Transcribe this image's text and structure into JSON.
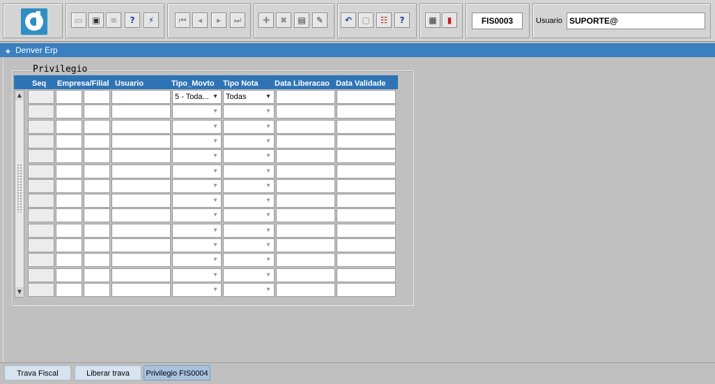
{
  "toolbar": {
    "form_code": "FIS0003",
    "user_label": "Usuario",
    "user_value": "SUPORTE@",
    "buttons": [
      {
        "name": "save-icon",
        "glyph": "▭"
      },
      {
        "name": "print-preview-icon",
        "glyph": "▣"
      },
      {
        "name": "printer-icon",
        "glyph": "≡"
      },
      {
        "name": "query-help-icon",
        "glyph": "?"
      },
      {
        "name": "execute-query-icon",
        "glyph": "⚡"
      },
      {
        "name": "first-record-icon",
        "glyph": "⏮"
      },
      {
        "name": "previous-record-icon",
        "glyph": "◂"
      },
      {
        "name": "next-record-icon",
        "glyph": "▸"
      },
      {
        "name": "last-record-icon",
        "glyph": "⏭"
      },
      {
        "name": "insert-record-icon",
        "glyph": "✚"
      },
      {
        "name": "delete-record-icon",
        "glyph": "✖"
      },
      {
        "name": "duplicate-record-icon",
        "glyph": "▤"
      },
      {
        "name": "edit-field-icon",
        "glyph": "✎"
      },
      {
        "name": "undo-icon",
        "glyph": "↶"
      },
      {
        "name": "clipboard-icon",
        "glyph": "▢"
      },
      {
        "name": "list-values-icon",
        "glyph": "☷"
      },
      {
        "name": "help-icon",
        "glyph": "?"
      },
      {
        "name": "menu-icon",
        "glyph": "▦"
      },
      {
        "name": "exit-icon",
        "glyph": "▮"
      }
    ]
  },
  "window": {
    "title": "Denver Erp"
  },
  "frame": {
    "title": "Privilegio"
  },
  "grid": {
    "headers": [
      "Seq",
      "Empresa/Filial",
      "Usuario",
      "Tipo_Movto",
      "Tipo Nota",
      "Data Liberacao",
      "Data  Validade"
    ],
    "rows": [
      {
        "tipo_movto": "5 - Toda...",
        "tipo_nota": "Todas"
      },
      {
        "tipo_movto": "",
        "tipo_nota": ""
      },
      {
        "tipo_movto": "",
        "tipo_nota": ""
      },
      {
        "tipo_movto": "",
        "tipo_nota": ""
      },
      {
        "tipo_movto": "",
        "tipo_nota": ""
      },
      {
        "tipo_movto": "",
        "tipo_nota": ""
      },
      {
        "tipo_movto": "",
        "tipo_nota": ""
      },
      {
        "tipo_movto": "",
        "tipo_nota": ""
      },
      {
        "tipo_movto": "",
        "tipo_nota": ""
      },
      {
        "tipo_movto": "",
        "tipo_nota": ""
      },
      {
        "tipo_movto": "",
        "tipo_nota": ""
      },
      {
        "tipo_movto": "",
        "tipo_nota": ""
      },
      {
        "tipo_movto": "",
        "tipo_nota": ""
      },
      {
        "tipo_movto": "",
        "tipo_nota": ""
      }
    ]
  },
  "tabs": [
    {
      "label": "Trava Fiscal",
      "active": false
    },
    {
      "label": "Liberar trava",
      "active": false
    },
    {
      "label": "Privilegio FIS0004",
      "active": true
    }
  ],
  "colors": {
    "title_bar": "#3a7fc0",
    "grid_header": "#2e74b5",
    "active_tab": "#a9c3df"
  }
}
